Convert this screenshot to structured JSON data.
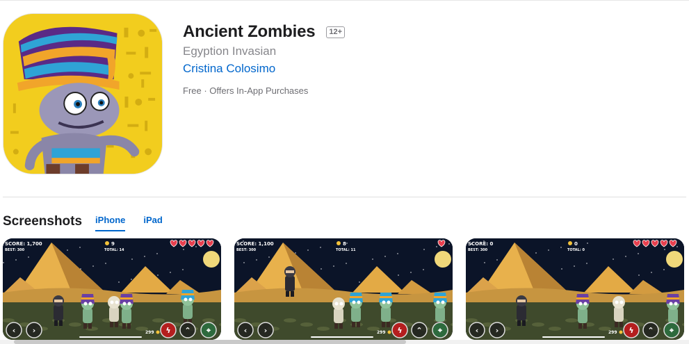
{
  "app": {
    "title": "Ancient Zombies",
    "age_rating": "12+",
    "subtitle": "Egyption Invasian",
    "developer": "Cristina Colosimo",
    "price_line": "Free · Offers In-App Purchases",
    "icon": "pharaoh-zombie-app-icon"
  },
  "screenshots": {
    "title": "Screenshots",
    "tabs": [
      {
        "label": "iPhone",
        "active": true
      },
      {
        "label": "iPad",
        "active": false
      }
    ],
    "items": [
      {
        "score": "SCORE: 1,700",
        "best": "BEST: 300",
        "total": "TOTAL: 14",
        "coins": "9",
        "hearts": 5,
        "bottom_coins": "299"
      },
      {
        "score": "SCORE: 1,100",
        "best": "BEST: 300",
        "total": "TOTAL: 11",
        "coins": "8",
        "hearts": 1,
        "bottom_coins": "299"
      },
      {
        "score": "SCORE: 0",
        "best": "BEST: 300",
        "total": "TOTAL: 0",
        "coins": "0",
        "hearts": 5,
        "bottom_coins": "299"
      }
    ]
  },
  "colors": {
    "link": "#0066cc",
    "icon_yellow": "#f3cf1f",
    "night_sky": "#0b1428",
    "sand": "#d9a441",
    "heart": "#e8404f"
  }
}
